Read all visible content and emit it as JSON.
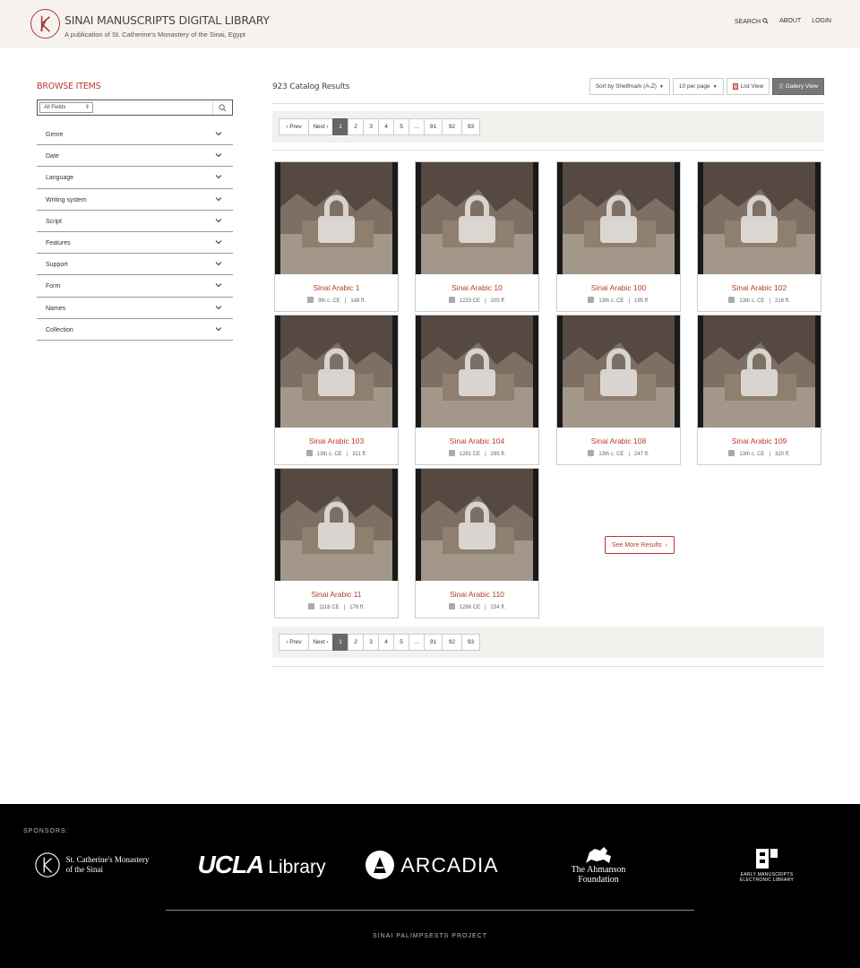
{
  "header": {
    "title": "SINAI MANUSCRIPTS DIGITAL LIBRARY",
    "subtitle": "A publication of St. Catherine's Monastery of the Sinai, Egypt",
    "nav": {
      "search": "SEARCH",
      "about": "ABOUT",
      "login": "LOGIN"
    }
  },
  "sidebar": {
    "title": "BROWSE ITEMS",
    "search": {
      "field_select": "All Fields",
      "placeholder": ""
    },
    "facets": [
      "Genre",
      "Date",
      "Language",
      "Writing system",
      "Script",
      "Features",
      "Support",
      "Form",
      "Names",
      "Collection"
    ]
  },
  "results": {
    "count": "923 Catalog Results",
    "sort": "Sort by Shelfmark (A-Z)",
    "per_page": "10 per page",
    "list_view": "List View",
    "gallery_view": "Gallery View",
    "pagination": [
      "‹ Prev",
      "Next ›",
      "1",
      "2",
      "3",
      "4",
      "5",
      "…",
      "91",
      "92",
      "93"
    ],
    "current_page": "1",
    "see_more": "See More Results",
    "items": [
      {
        "title": "Sinai Arabic 1",
        "date": "9th c. CE",
        "folios": "148 ff."
      },
      {
        "title": "Sinai Arabic 10",
        "date": "1233 CE",
        "folios": "205 ff."
      },
      {
        "title": "Sinai Arabic 100",
        "date": "13th c. CE",
        "folios": "195 ff."
      },
      {
        "title": "Sinai Arabic 102",
        "date": "13th c. CE",
        "folios": "218 ff."
      },
      {
        "title": "Sinai Arabic 103",
        "date": "13th c. CE",
        "folios": "311 ff."
      },
      {
        "title": "Sinai Arabic 104",
        "date": "1281 CE",
        "folios": "295 ff."
      },
      {
        "title": "Sinai Arabic 108",
        "date": "13th c. CE",
        "folios": "247 ff."
      },
      {
        "title": "Sinai Arabic 109",
        "date": "13th c. CE",
        "folios": "320 ff."
      },
      {
        "title": "Sinai Arabic 11",
        "date": "1116 CE",
        "folios": "176 ff."
      },
      {
        "title": "Sinai Arabic 110",
        "date": "1286 CE",
        "folios": "234 ff."
      }
    ],
    "meta_separator": "|"
  },
  "footer": {
    "sponsors_label": "SPONSORS:",
    "sponsors": {
      "stc_line1": "St. Catherine's Monastery",
      "stc_line2": "of the Sinai",
      "ucla_bold": "UCLA",
      "ucla_rest": "Library",
      "arcadia": "ARCADIA",
      "ahmanson_line1": "The Ahmanson",
      "ahmanson_line2": "Foundation",
      "emel_line1": "EARLY MANUSCRIPTS",
      "emel_line2": "ELECTRONIC LIBRARY"
    },
    "project": "SINAI PALIMPSESTS PROJECT"
  },
  "colors": {
    "accent": "#b8392e",
    "header_bg": "#f6f3ef",
    "footer_bg": "#000000",
    "active_page": "#666666"
  }
}
